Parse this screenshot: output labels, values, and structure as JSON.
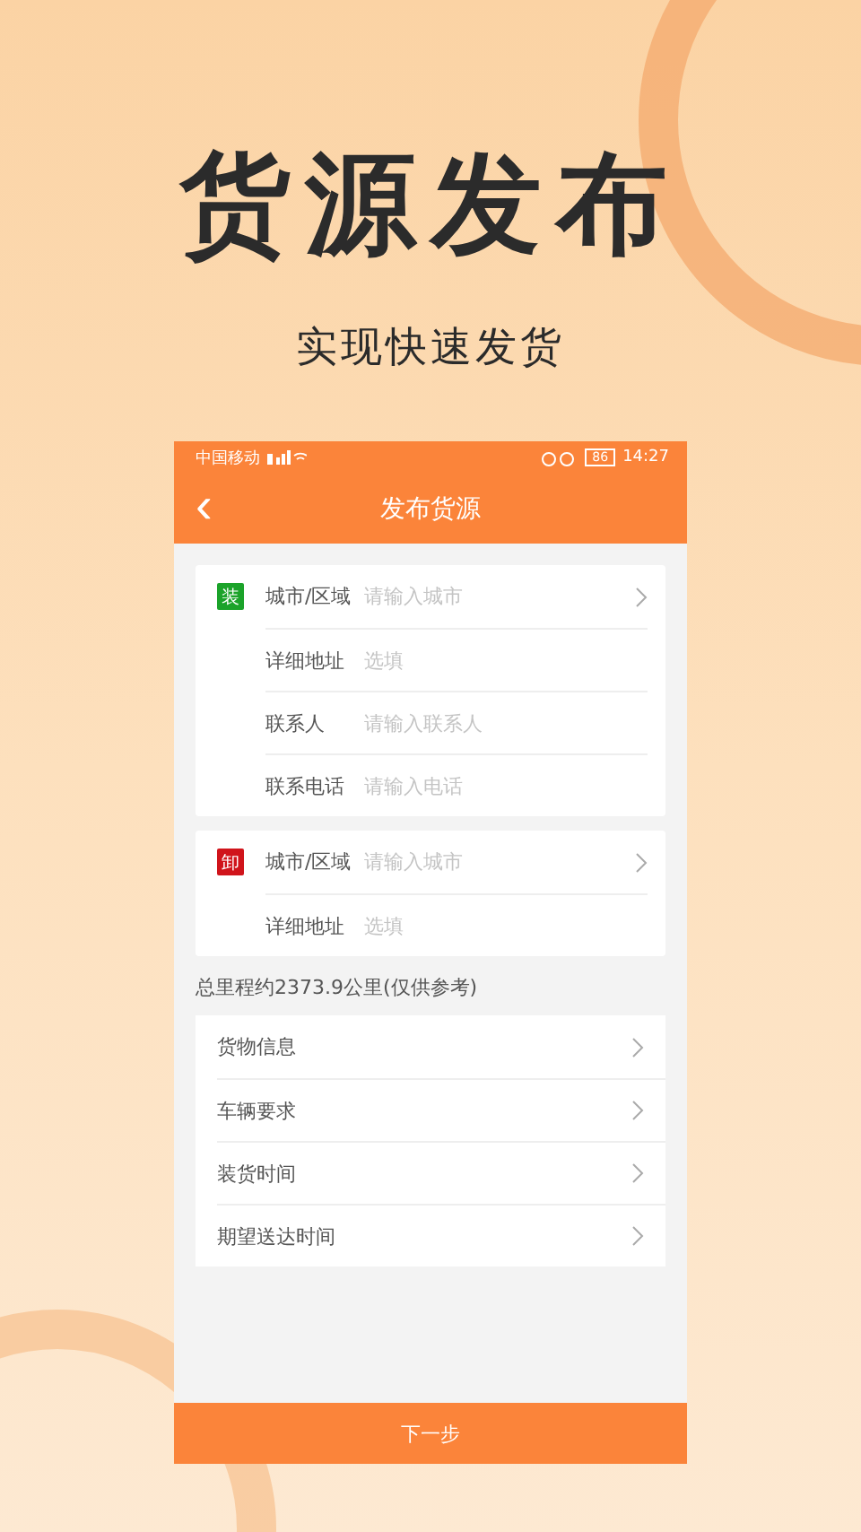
{
  "promo": {
    "title": "货源发布",
    "subtitle": "实现快速发货"
  },
  "status_bar": {
    "carrier": "中国移动",
    "battery": "86",
    "time": "14:27"
  },
  "header": {
    "back": "‹",
    "title": "发布货源"
  },
  "stops": [
    {
      "badge": {
        "text": "装",
        "color": "#1ba32a"
      },
      "rows": [
        {
          "label": "城市/区域",
          "placeholder": "请输入城市",
          "arrow": true
        },
        {
          "label": "详细地址",
          "placeholder": "选填",
          "arrow": false
        },
        {
          "label": "联系人",
          "placeholder": "请输入联系人",
          "arrow": false
        },
        {
          "label": "联系电话",
          "placeholder": "请输入电话",
          "arrow": false
        }
      ]
    },
    {
      "badge": {
        "text": "卸",
        "color": "#d0141b"
      },
      "rows": [
        {
          "label": "城市/区域",
          "placeholder": "请输入城市",
          "arrow": true
        },
        {
          "label": "详细地址",
          "placeholder": "选填",
          "arrow": false
        }
      ]
    }
  ],
  "distance_note": "总里程约2373.9公里(仅供参考)",
  "menu": [
    {
      "label": "货物信息"
    },
    {
      "label": "车辆要求"
    },
    {
      "label": "装货时间"
    },
    {
      "label": "期望送达时间"
    }
  ],
  "next_button": "下一步"
}
